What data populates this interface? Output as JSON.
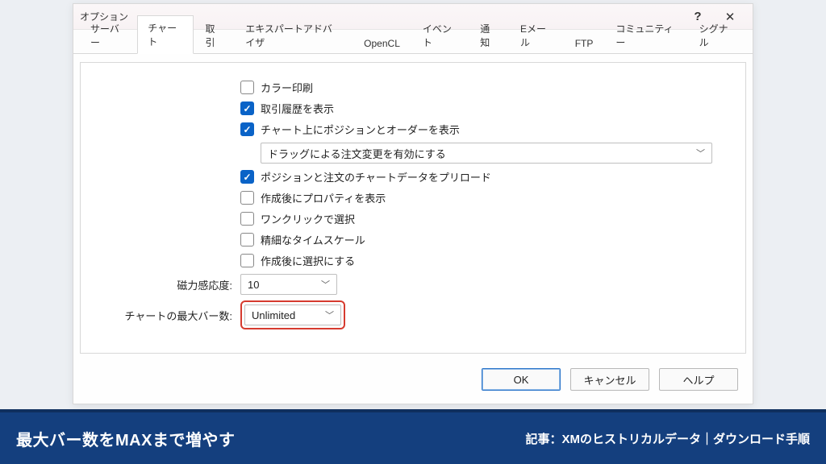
{
  "window": {
    "title": "オプション"
  },
  "tabs": [
    "サーバー",
    "チャート",
    "取引",
    "エキスパートアドバイザ",
    "OpenCL",
    "イベント",
    "通知",
    "Eメール",
    "FTP",
    "コミュニティー",
    "シグナル"
  ],
  "active_tab_index": 1,
  "checks": {
    "color_print": {
      "label": "カラー印刷",
      "checked": false
    },
    "trade_history": {
      "label": "取引履歴を表示",
      "checked": true
    },
    "positions_on_chart": {
      "label": "チャート上にポジションとオーダーを表示",
      "checked": true
    },
    "preload_data": {
      "label": "ポジションと注文のチャートデータをプリロード",
      "checked": true
    },
    "show_props": {
      "label": "作成後にプロパティを表示",
      "checked": false
    },
    "one_click": {
      "label": "ワンクリックで選択",
      "checked": false
    },
    "precise_time": {
      "label": "精細なタイムスケール",
      "checked": false
    },
    "select_after": {
      "label": "作成後に選択にする",
      "checked": false
    }
  },
  "drag_order_select": {
    "value": "ドラッグによる注文変更を有効にする"
  },
  "sensitivity": {
    "label": "磁力感応度:",
    "value": "10"
  },
  "max_bars": {
    "label": "チャートの最大バー数:",
    "value": "Unlimited"
  },
  "buttons": {
    "ok": "OK",
    "cancel": "キャンセル",
    "help": "ヘルプ"
  },
  "banner": {
    "left": "最大バー数をMAXまで増やす",
    "right": "記事：XMのヒストリカルデータ｜ダウンロード手順"
  }
}
